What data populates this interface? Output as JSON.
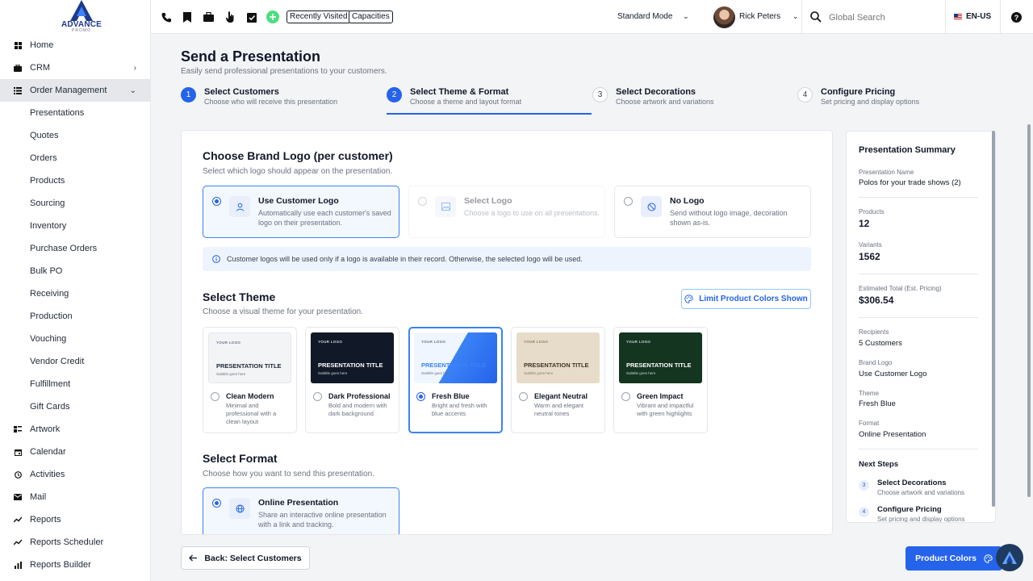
{
  "brand": {
    "name": "ADVANCE",
    "tagline": "PROMO"
  },
  "sidebar": {
    "items": [
      {
        "label": "Home",
        "icon": "grid-icon"
      },
      {
        "label": "CRM",
        "icon": "briefcase-icon"
      },
      {
        "label": "Order Management",
        "icon": "list-icon"
      },
      {
        "label": "Presentations"
      },
      {
        "label": "Quotes"
      },
      {
        "label": "Orders"
      },
      {
        "label": "Products"
      },
      {
        "label": "Sourcing"
      },
      {
        "label": "Inventory"
      },
      {
        "label": "Purchase Orders"
      },
      {
        "label": "Bulk PO"
      },
      {
        "label": "Receiving"
      },
      {
        "label": "Production"
      },
      {
        "label": "Vouching"
      },
      {
        "label": "Vendor Credit"
      },
      {
        "label": "Fulfillment"
      },
      {
        "label": "Gift Cards"
      },
      {
        "label": "Artwork",
        "icon": "artwork-icon"
      },
      {
        "label": "Calendar",
        "icon": "calendar-icon"
      },
      {
        "label": "Activities",
        "icon": "clock-icon"
      },
      {
        "label": "Mail",
        "icon": "mail-icon"
      },
      {
        "label": "Reports",
        "icon": "trend-icon"
      },
      {
        "label": "Reports Scheduler",
        "icon": "trend-icon"
      },
      {
        "label": "Reports Builder",
        "icon": "bar-chart-icon"
      }
    ]
  },
  "topbar": {
    "chips": [
      "Recently Visited",
      "Capacities"
    ],
    "mode": "Standard Mode",
    "user": "Rick Peters",
    "search_placeholder": "Global Search",
    "locale": "EN-US"
  },
  "page": {
    "title": "Send a Presentation",
    "subtitle": "Easily send professional presentations to your customers."
  },
  "steps": [
    {
      "num": "1",
      "title": "Select Customers",
      "desc": "Choose who will receive this presentation"
    },
    {
      "num": "2",
      "title": "Select Theme & Format",
      "desc": "Choose a theme and layout format"
    },
    {
      "num": "3",
      "title": "Select Decorations",
      "desc": "Choose artwork and variations"
    },
    {
      "num": "4",
      "title": "Configure Pricing",
      "desc": "Set pricing and display options"
    }
  ],
  "logo_section": {
    "title": "Choose Brand Logo (per customer)",
    "subtitle": "Select which logo should appear on the presentation.",
    "options": [
      {
        "title": "Use Customer Logo",
        "desc": "Automatically use each customer's saved logo on their presentation."
      },
      {
        "title": "Select Logo",
        "desc": "Choose a logo to use on all presentations."
      },
      {
        "title": "No Logo",
        "desc": "Send without logo image, decoration shown as-is."
      }
    ],
    "info": "Customer logos will be used only if a logo is available in their record. Otherwise, the selected logo will be used."
  },
  "theme_section": {
    "title": "Select Theme",
    "subtitle": "Choose a visual theme for your presentation.",
    "limit_button": "Limit Product Colors Shown",
    "thumb_logo": "YOUR LOGO",
    "thumb_title": "PRESENTATION TITLE",
    "thumb_subtitle": "Subtitle goes here",
    "themes": [
      {
        "name": "Clean Modern",
        "desc": "Minimal and professional with a clean layout"
      },
      {
        "name": "Dark Professional",
        "desc": "Bold and modern with dark background"
      },
      {
        "name": "Fresh Blue",
        "desc": "Bright and fresh with blue accents"
      },
      {
        "name": "Elegant Neutral",
        "desc": "Warm and elegant neutral tones"
      },
      {
        "name": "Green Impact",
        "desc": "Vibrant and impactful with green highlights"
      }
    ]
  },
  "format_section": {
    "title": "Select Format",
    "subtitle": "Choose how you want to send this presentation.",
    "options": [
      {
        "title": "Online Presentation",
        "desc": "Share an interactive online presentation with a link and tracking."
      }
    ]
  },
  "summary": {
    "title": "Presentation Summary",
    "fields": [
      {
        "label": "Presentation Name",
        "value": "Polos for your trade shows (2)"
      },
      {
        "label": "Products",
        "value": "12"
      },
      {
        "label": "Variants",
        "value": "1562"
      },
      {
        "label": "Estimated Total (Est. Pricing)",
        "value": "$306.54"
      },
      {
        "label": "Recipients",
        "value": "5 Customers"
      },
      {
        "label": "Brand Logo",
        "value": "Use Customer Logo"
      },
      {
        "label": "Theme",
        "value": "Fresh Blue"
      },
      {
        "label": "Format",
        "value": "Online Presentation"
      }
    ],
    "next_steps_title": "Next Steps",
    "next_steps": [
      {
        "num": "3",
        "title": "Select Decorations",
        "desc": "Choose artwork and variations"
      },
      {
        "num": "4",
        "title": "Configure Pricing",
        "desc": "Set pricing and display options"
      }
    ]
  },
  "footer": {
    "back_label": "Back: Select Customers",
    "next_label": "Product Colors"
  },
  "colors": {
    "accent": "#2563eb",
    "sidebar_active": "#e5e7eb"
  }
}
